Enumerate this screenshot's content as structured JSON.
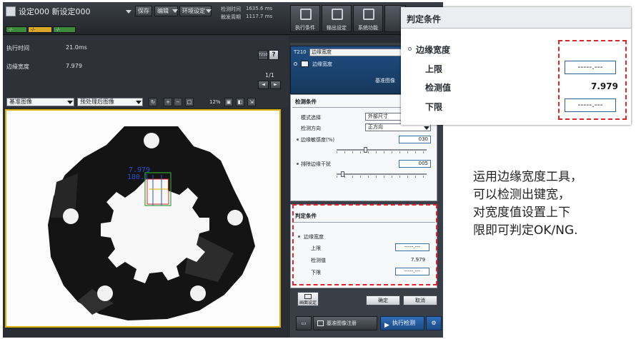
{
  "window": {
    "title": "设定000 新设定000",
    "save_label": "保存",
    "edit_label": "编辑",
    "env_label": "环境设定"
  },
  "stats": [
    {
      "label": "检测时间",
      "value": "1635.6 ms"
    },
    {
      "label": "触发周期",
      "value": "1117.7 ms"
    }
  ],
  "slots": [
    "-/-",
    "-/-",
    "-/-"
  ],
  "toolbar_buttons": [
    {
      "label": "执行条件",
      "icon": "condition-icon"
    },
    {
      "label": "输出设定",
      "icon": "output-icon"
    },
    {
      "label": "系统功能",
      "icon": "system-icon"
    }
  ],
  "info": {
    "rows": [
      {
        "label": "执行时间",
        "value": "21.0ms"
      },
      {
        "label": "边缘宽度",
        "value": "7.979"
      }
    ],
    "tool_id": "T210",
    "help_glyph": "?",
    "page": "1/1",
    "nav_prev": "◄",
    "nav_next": "►"
  },
  "image_toolbar": {
    "left_select": "基准图像",
    "right_select": "预处理后图像",
    "zoom": "12%"
  },
  "overlay": {
    "measure_value": "7.979",
    "angle_value": "180.1"
  },
  "tool_panel": {
    "id": "T210",
    "select_value": "边缘宽度",
    "item_label": "边缘宽度",
    "ref_label": "基准图像"
  },
  "detect_conditions": {
    "title": "检测条件",
    "mode_label": "模式选择",
    "mode_value": "外部尺寸",
    "direction_label": "检测方向",
    "direction_value": "正方向",
    "sensitivity_label": "边缘敏感度(%)",
    "sensitivity_value": "030",
    "sensitivity_level": 0.3,
    "interference_label": "排除边缘干扰",
    "interference_value": "005",
    "interference_level": 0.05
  },
  "judge_conditions": {
    "title": "判定条件",
    "item_label": "边缘宽度",
    "upper_label": "上限",
    "upper_value": "-----.---",
    "measured_label": "检测值",
    "measured_value": "7.979",
    "lower_label": "下限",
    "lower_value": "-----.---"
  },
  "bottom": {
    "screen_settings_label": "画面设定",
    "ok_label": "确定",
    "cancel_label": "取消",
    "register_label": "基准图像注册",
    "run_label": "执行检测"
  },
  "zoom_popup": {
    "title": "判定条件",
    "item_label": "边缘宽度",
    "upper_label": "上限",
    "upper_value": "-----.---",
    "measured_label": "检测值",
    "measured_value": "7.979",
    "lower_label": "下限",
    "lower_value": "-----.---"
  },
  "caption": {
    "lines": [
      "运用边缘宽度工具，",
      "可以检测出键宽，",
      "对宽度值设置上下",
      "限即可判定OK/NG."
    ]
  },
  "colors": {
    "highlight_dash": "#e0262a",
    "image_frame": "#d7b400",
    "panel_blue": "#1f4f84"
  }
}
